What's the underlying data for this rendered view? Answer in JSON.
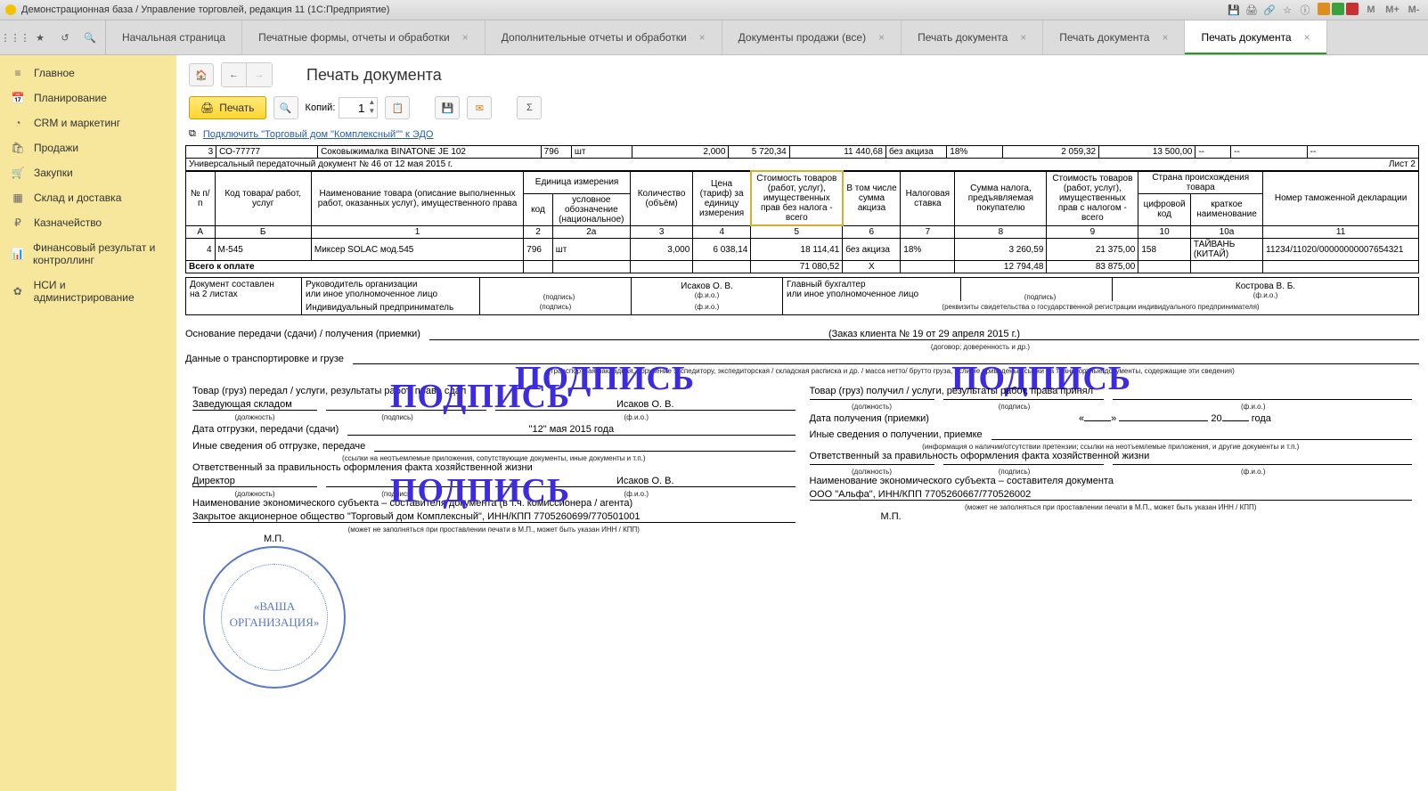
{
  "title": "Демонстрационная база / Управление торговлей, редакция 11  (1С:Предприятие)",
  "mbuttons": [
    "M",
    "M+",
    "M-"
  ],
  "tabs": [
    {
      "label": "Начальная страница",
      "closable": false
    },
    {
      "label": "Печатные формы, отчеты и обработки",
      "closable": true
    },
    {
      "label": "Дополнительные отчеты и обработки",
      "closable": true
    },
    {
      "label": "Документы продажи (все)",
      "closable": true
    },
    {
      "label": "Печать документа",
      "closable": true
    },
    {
      "label": "Печать документа",
      "closable": true
    },
    {
      "label": "Печать документа",
      "closable": true,
      "active": true
    }
  ],
  "sidebar": [
    {
      "icon": "≡",
      "label": "Главное"
    },
    {
      "icon": "📅",
      "label": "Планирование"
    },
    {
      "icon": "◔",
      "label": "CRM и маркетинг"
    },
    {
      "icon": "🛍",
      "label": "Продажи"
    },
    {
      "icon": "🛒",
      "label": "Закупки"
    },
    {
      "icon": "▦",
      "label": "Склад и доставка"
    },
    {
      "icon": "₽",
      "label": "Казначейство"
    },
    {
      "icon": "📊",
      "label": "Финансовый результат и контроллинг"
    },
    {
      "icon": "✿",
      "label": "НСИ и администрирование"
    }
  ],
  "page_heading": "Печать документа",
  "toolbar": {
    "print": "Печать",
    "copies_label": "Копий:",
    "copies_value": "1"
  },
  "link": "Подключить \"Торговый дом \"Комплексный\"\" к ЭДО",
  "row3": {
    "n": "3",
    "code": "СО-77777",
    "name": "Соковыжималка  BINATONE JE 102",
    "kod": "796",
    "ed": "шт",
    "qty": "2,000",
    "price": "5 720,34",
    "sum": "11 440,68",
    "akciz": "без акциза",
    "rate": "18%",
    "tax": "2 059,32",
    "total": "13 500,00",
    "d1": "--",
    "d2": "--",
    "d3": "--"
  },
  "sheetline": "Универсальный передаточный документ № 46 от 12 мая 2015 г.",
  "sheetpage": "Лист 2",
  "headers": {
    "n": "№ п/п",
    "code": "Код товара/ работ, услуг",
    "name": "Наименование товара (описание выполненных работ, оказанных услуг), имущественного права",
    "ed_group": "Единица измерения",
    "kod": "код",
    "ed": "условное обозначение (национальное)",
    "qty": "Количество (объём)",
    "price": "Цена (тариф) за единицу измерения",
    "sum": "Стоимость товаров (работ, услуг), имущественных прав без налога - всего",
    "akciz": "В том числе сумма акциза",
    "rate": "Налоговая ставка",
    "tax": "Сумма налога, предъявляемая покупателю",
    "total": "Стоимость товаров (работ, услуг), имущественных прав с налогом - всего",
    "country_group": "Страна происхождения товара",
    "cif": "цифровой код",
    "kname": "краткое наименование",
    "decl": "Номер таможенной декларации"
  },
  "num_row": [
    "А",
    "Б",
    "1",
    "2",
    "2а",
    "3",
    "4",
    "5",
    "6",
    "7",
    "8",
    "9",
    "10",
    "10а",
    "11"
  ],
  "row4": {
    "n": "4",
    "code": "М-545",
    "name": "Миксер SOLAC мод.545",
    "kod": "796",
    "ed": "шт",
    "qty": "3,000",
    "price": "6 038,14",
    "sum": "18 114,41",
    "akciz": "без акциза",
    "rate": "18%",
    "tax": "3 260,59",
    "total": "21 375,00",
    "cif": "158",
    "kname": "ТАЙВАНЬ (КИТАЙ)",
    "decl": "11234/11020/00000000007654321"
  },
  "total_row": {
    "label": "Всего к оплате",
    "sum": "71 080,52",
    "akciz": "Х",
    "tax": "12 794,48",
    "total": "83 875,00"
  },
  "doc_compose": {
    "l1": "Документ составлен",
    "l2": "на 2 листах"
  },
  "sig1": {
    "a": "Руководитель организации",
    "b": "или иное уполномоченное лицо",
    "c": "Индивидуальный предприниматель",
    "p": "(подпись)",
    "f": "(ф.и.о.)",
    "name1": "Исаков О. В.",
    "glav": "Главный бухгалтер",
    "glav2": "или иное уполномоченное лицо",
    "name2": "Кострова В. Б.",
    "rek": "(реквизиты свидетельства о государственной  регистрации индивидуального предпринимателя)"
  },
  "watermark": "ПОДПИСЬ",
  "basis": {
    "label": "Основание передачи (сдачи) / получения (приемки)",
    "val": "(Заказ клиента № 19 от 29 апреля 2015 г.)",
    "note": "(договор; доверенность и др.)"
  },
  "transport": {
    "label": "Данные о транспортировке и грузе",
    "note": "(транспортная накладная, поручение экспедитору, экспедиторская / складская расписка и др. / масса нетто/ брутто груза, если не приведены ссылки на транспортные документы, содержащие эти сведения)"
  },
  "left_col": {
    "h": "Товар (груз) передал / услуги, результаты работ, права сдал",
    "pos": "Заведующая складом",
    "name": "Исаков О. В.",
    "pos_note": "(должность)",
    "sig_note": "(подпись)",
    "fio_note": "(ф.и.о.)",
    "date_label": "Дата отгрузки, передачи (сдачи)",
    "date_val": "\"12\" мая 2015 года",
    "other": "Иные сведения об отгрузке, передаче",
    "other_note": "(ссылки на неотъемлемые приложения, сопутствующие документы, иные документы и т.п.)",
    "resp": "Ответственный за правильность оформления факта хозяйственной жизни",
    "resp_pos": "Директор",
    "resp_name": "Исаков О. В.",
    "org_label": "Наименование экономического субъекта – составителя документа (в т.ч. комиссионера / агента)",
    "org_val": "Закрытое акционерное общество \"Торговый дом Комплексный\", ИНН/КПП 7705260699/770501001",
    "org_note": "(может не заполняться при проставлении печати в М.П., может быть указан ИНН / КПП)",
    "mp": "М.П."
  },
  "right_col": {
    "h": "Товар (груз) получил / услуги, результаты работ, права принял",
    "pos_note": "(должность)",
    "sig_note": "(подпись)",
    "fio_note": "(ф.и.о.)",
    "date_label": "Дата получения (приемки)",
    "date_val1": "«",
    "date_val2": "»",
    "date_val3": "20",
    "date_val4": "года",
    "other": "Иные сведения о получении, приемке",
    "other_note": "(информация о наличии/отсутствии претензии; ссылки на неотъемлемые приложения,  и другие  документы и т.п.)",
    "resp": "Ответственный за правильность оформления факта хозяйственной жизни",
    "org_label": "Наименование экономического субъекта – составителя документа",
    "org_val": "ООО \"Альфа\", ИНН/КПП 7705260667/770526002",
    "org_note": "(может не заполняться при проставлении печати в М.П., может быть указан ИНН / КПП)",
    "mp": "М.П."
  },
  "stamp": {
    "l1": "«ВАША",
    "l2": "ОРГАНИЗАЦИЯ»"
  }
}
